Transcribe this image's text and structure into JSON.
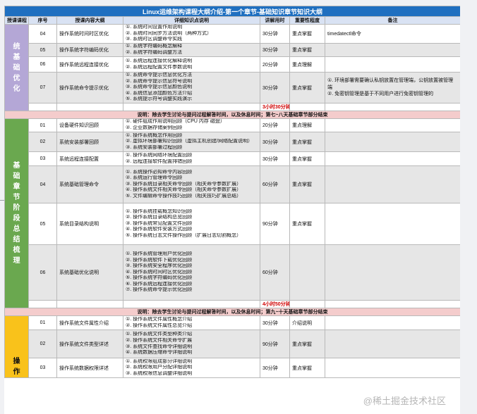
{
  "title": "Linux运维架构课程大纲介绍-第一个章节-基础知识章节知识大纲",
  "headers": {
    "section": "授课课程",
    "seq": "序号",
    "content": "授课内容大纲",
    "points": "详细知识点说明",
    "time": "讲解用时",
    "importance": "重要性程度",
    "remark": "备注"
  },
  "sections": {
    "s1": [
      "统",
      "基",
      "础",
      "优",
      "化"
    ],
    "s2": [
      "基",
      "础",
      "章",
      "节",
      "阶",
      "段",
      "总",
      "结",
      "梳",
      "理"
    ],
    "s3": [
      "操",
      "作"
    ]
  },
  "rows": {
    "r1": {
      "seq": "04",
      "content": "操作系统时间时区优化",
      "points": [
        "①. 系统时间设置作用说明",
        "②. 系统时间同步方法说明（两种方式）",
        "③. 系统时区调整命令实践"
      ],
      "time": "30分钟",
      "importance": "重点掌握",
      "remark": "timedatectl命令"
    },
    "r2": {
      "seq": "05",
      "content": "操作系统字符编码优化",
      "points": [
        "①. 系统字符编码概念解释",
        "②. 系统字符编码调整方法"
      ],
      "time": "30分钟",
      "importance": "重点掌握",
      "remark": ""
    },
    "r3": {
      "seq": "06",
      "content": "操作系统远程连接优化",
      "points": [
        "①. 系统远程连接优化解释说明",
        "②. 系统远程配置文件参数说明"
      ],
      "time": "20分钟",
      "importance": "重点理解",
      "remark": ""
    },
    "r4": {
      "seq": "07",
      "content": "操作系统命令提示优化",
      "points": [
        "①. 系统命令提示信息优化方法",
        "②. 系统命令提示信息符号说明",
        "③. 系统命令提示信息颜色说明",
        "④. 系统信息添加颜色方法介绍",
        "⑤. 系统提示符号调整实践演示"
      ],
      "time": "30分钟",
      "importance": "重点掌握",
      "remark": [
        "①. 环境部署需要确认私钥放置在管理端，公钥放置被管理端",
        "②. 免密钥管理是基于不同用户进行免密钥管理的"
      ]
    },
    "total1": "3小时30分钟",
    "note1": "说明：除去学生讨论与提问过程解答时间，以及休息时间；第七~八天基础章节部分结束",
    "r5": {
      "seq": "01",
      "content": "设备硬件知识回顾",
      "points": [
        "①. 硬件组成作用说明回顾（CPU 内存 磁盘）",
        "②. 企业数据存储案例回顾"
      ],
      "time": "20分钟",
      "importance": "重点理解",
      "remark": ""
    },
    "r6": {
      "seq": "02",
      "content": "系统安装部署回顾",
      "points": [
        "①. 操作系统概念作用回顾",
        "②. 虚拟环境部署知识回顾（虚拟主机创建/网络配置说明）",
        "③. 系统安装部署过程回顾"
      ],
      "time": "30分钟",
      "importance": "重点掌握",
      "remark": ""
    },
    "r7": {
      "seq": "03",
      "content": "系统远程连接配置",
      "points": [
        "①. 操作系统网络环境配置回顾",
        "②. 远程连接软件配置排错回顾"
      ],
      "time": "30分钟",
      "importance": "重点掌握",
      "remark": ""
    },
    "r8": {
      "seq": "04",
      "content": "系统基础管理命令",
      "points": [
        "①. 系统操作必知命令内容回顾",
        "②. 系统运行管理命令回顾",
        "③. 操作系统目录相关命令回顾（相关命令参数扩展）",
        "④. 操作系统文件相关命令回顾（相关命令参数扩展）",
        "⑤. 文件编辑命令操作技巧回顾（相关技巧扩展总结）"
      ],
      "time": "60分钟",
      "importance": "重点掌握",
      "remark": ""
    },
    "r9": {
      "seq": "05",
      "content": "系统目录结构说明",
      "points": [
        "①. 操作系统挂载概念知识回顾",
        "②. 操作系统目录结构总览回顾",
        "③. 操作系统常见配置文件回顾",
        "④. 操作系统软件安装方式回顾",
        "⑤. 操作系统日志文件操作回顾（扩展日志切割概念）"
      ],
      "time": "90分钟",
      "importance": "重点掌握",
      "remark": ""
    },
    "r10": {
      "seq": "06",
      "content": "系统基础优化说明",
      "points": [
        "①. 操作系统管理用户优化回顾",
        "②. 操作系统软件下载优化回顾",
        "③. 操作系统安全程序优化回顾",
        "④. 操作系统时间时区优化回顾",
        "⑤. 操作系统字符编码优化回顾",
        "⑥. 操作系统远程连接优化回顾",
        "⑦. 操作系统命令提示优化回顾"
      ],
      "time": "60分钟",
      "importance": "",
      "remark": ""
    },
    "total2": "4小时50分钟",
    "note2": "说明：除去学生讨论与提问过程解答时间，以及休息时间；第九~十天基础章节部分结束",
    "r11": {
      "seq": "01",
      "content": "操作系统文件属性介绍",
      "points": [
        "①. 操作系统文件属性概念介绍",
        "②. 操作系统文件属性总览介绍"
      ],
      "time": "30分钟",
      "importance": "介绍说明",
      "remark": ""
    },
    "r12": {
      "seq": "02",
      "content": "操作系统文件类型详述",
      "points": [
        "①. 操作系统文件类型种类介绍",
        "②. 操作系统文件相关命令扩展",
        "③. 系统文件查找命令详细说明",
        "④. 系统数据压缩命令详细说明"
      ],
      "time": "90分钟",
      "importance": "重点掌握",
      "remark": ""
    },
    "r13": {
      "seq": "03",
      "content": "操作系统数据权限详述",
      "points": [
        "①. 系统权限组成部分详细说明",
        "②. 系统权限用户分配详细说明",
        "③. 系统权限信息调整详细说明"
      ],
      "time": "30分钟",
      "importance": "重点掌握",
      "remark": ""
    }
  },
  "watermark": "@稀土掘金技术社区",
  "colors": {
    "title_bar": "#1f6fc0",
    "header": "#d9e2f3",
    "section1": "#b4a7d6",
    "section2": "#6aa84f",
    "section3": "#f9c21b",
    "note_row": "#f4cccc",
    "total_text": "#d00000"
  }
}
